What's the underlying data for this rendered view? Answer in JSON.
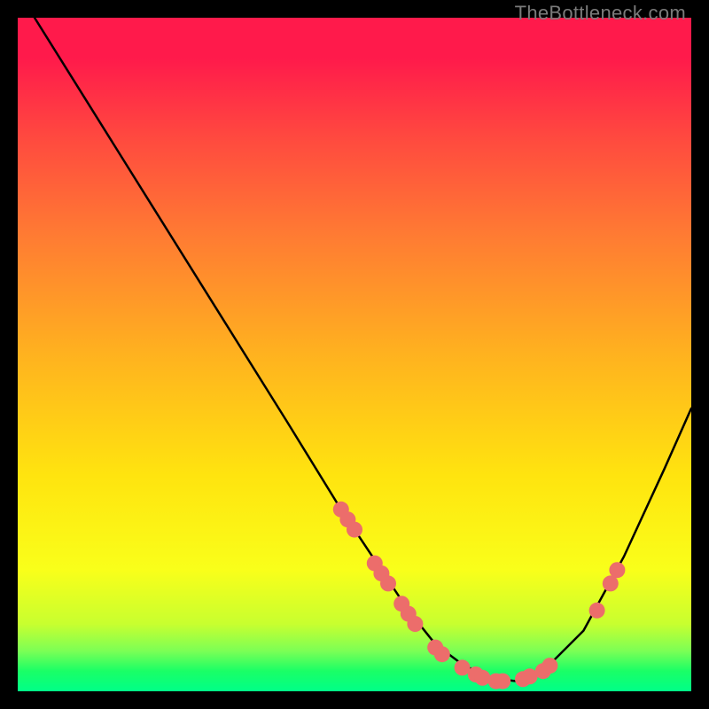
{
  "watermark": "TheBottleneck.com",
  "chart_data": {
    "type": "line",
    "title": "",
    "xlabel": "",
    "ylabel": "",
    "xlim": [
      0,
      100
    ],
    "ylim": [
      0,
      100
    ],
    "series": [
      {
        "name": "curve",
        "x": [
          2.5,
          10,
          20,
          30,
          40,
          48,
          54,
          58,
          62,
          66,
          70,
          74,
          78,
          84,
          90,
          96,
          100
        ],
        "y": [
          100,
          88,
          72,
          56,
          40,
          27,
          18,
          12,
          7,
          4,
          2,
          1.5,
          3,
          9,
          20,
          33,
          42
        ]
      }
    ],
    "markers": [
      {
        "x": 48,
        "y": 27
      },
      {
        "x": 49,
        "y": 25.5
      },
      {
        "x": 50,
        "y": 24
      },
      {
        "x": 53,
        "y": 19
      },
      {
        "x": 54,
        "y": 17.5
      },
      {
        "x": 55,
        "y": 16
      },
      {
        "x": 57,
        "y": 13
      },
      {
        "x": 58,
        "y": 11.5
      },
      {
        "x": 59,
        "y": 10
      },
      {
        "x": 62,
        "y": 6.5
      },
      {
        "x": 63,
        "y": 5.5
      },
      {
        "x": 66,
        "y": 3.5
      },
      {
        "x": 68,
        "y": 2.5
      },
      {
        "x": 69,
        "y": 2.0
      },
      {
        "x": 71,
        "y": 1.5
      },
      {
        "x": 72,
        "y": 1.5
      },
      {
        "x": 75,
        "y": 1.8
      },
      {
        "x": 76,
        "y": 2.2
      },
      {
        "x": 78,
        "y": 3.0
      },
      {
        "x": 79,
        "y": 3.8
      },
      {
        "x": 86,
        "y": 12.0
      },
      {
        "x": 88,
        "y": 16.0
      },
      {
        "x": 89,
        "y": 18.0
      }
    ],
    "colors": {
      "curve": "#000000",
      "marker": "#ec6d6b",
      "gradient_top": "#ff1a4b",
      "gradient_mid": "#ffe40f",
      "gradient_bottom": "#00ff88"
    }
  }
}
